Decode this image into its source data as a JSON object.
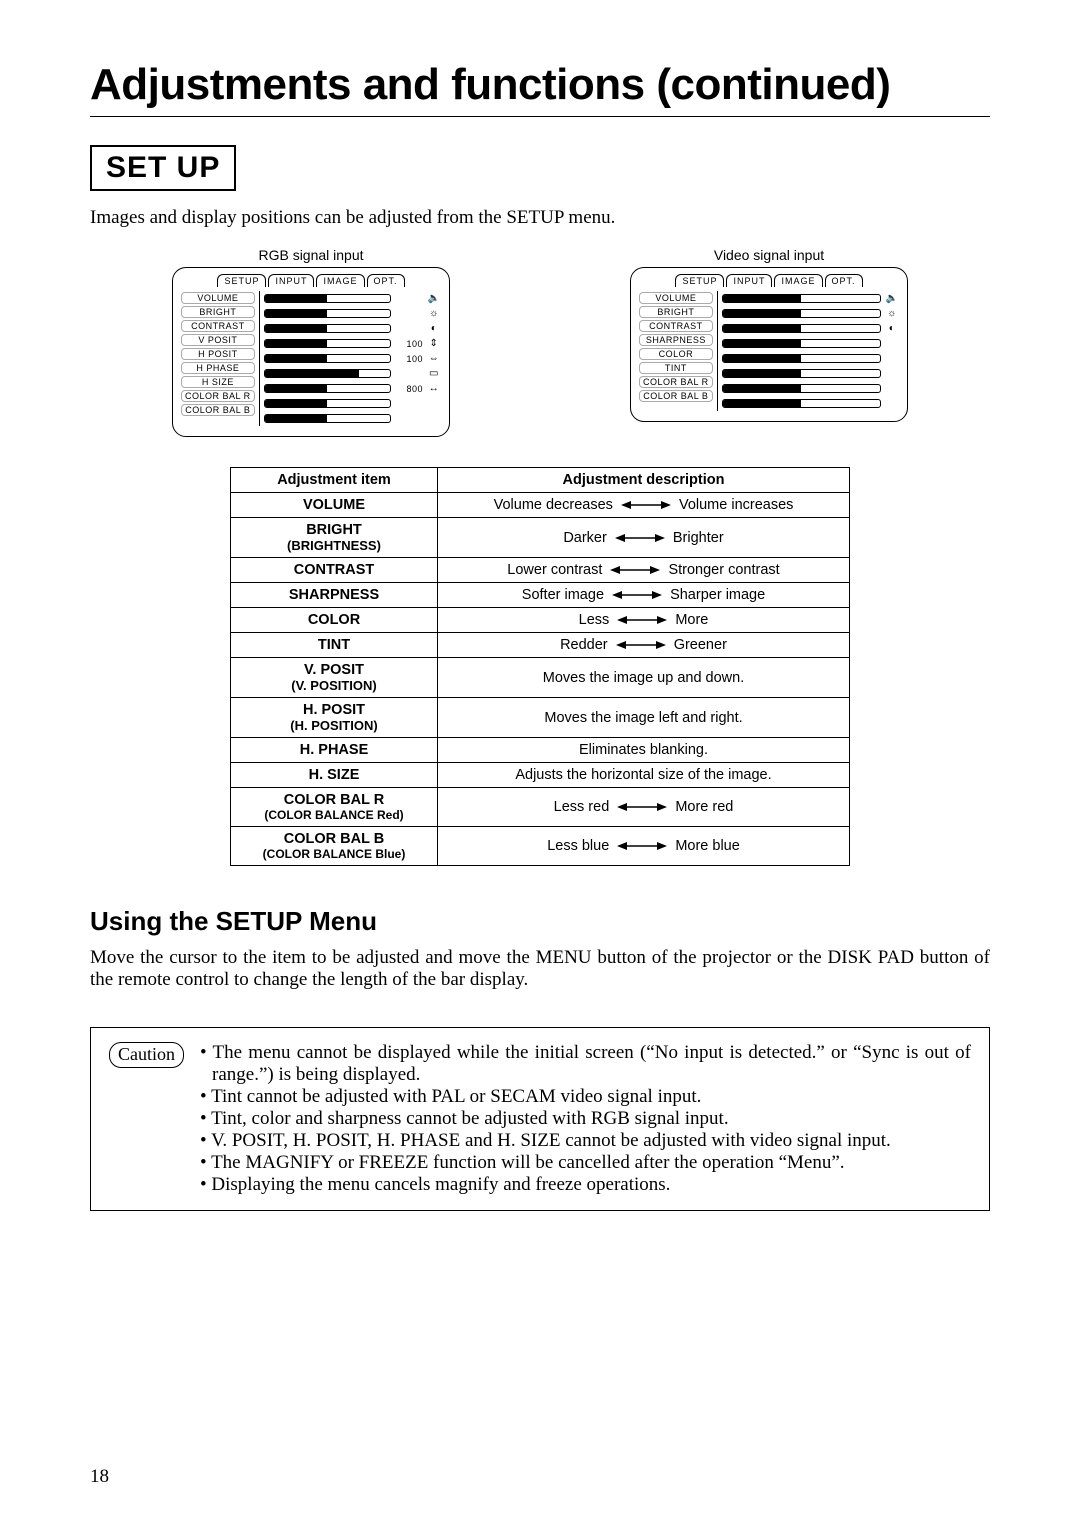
{
  "title": "Adjustments and functions (continued)",
  "setup_label": "SET UP",
  "intro": "Images and display positions can be adjusted from the SETUP menu.",
  "page_number": "18",
  "osd": {
    "tabs": [
      "SETUP",
      "INPUT",
      "IMAGE",
      "OPT."
    ],
    "rgb": {
      "caption": "RGB signal input",
      "items": [
        {
          "label": "VOLUME",
          "fill": 50,
          "num": "",
          "icon": "🔈"
        },
        {
          "label": "BRIGHT",
          "fill": 50,
          "num": "",
          "icon": "☼"
        },
        {
          "label": "CONTRAST",
          "fill": 50,
          "num": "",
          "icon": "◐"
        },
        {
          "label": "V  POSIT",
          "fill": 50,
          "num": "100",
          "icon": "⇕"
        },
        {
          "label": "H  POSIT",
          "fill": 50,
          "num": "100",
          "icon": "⇔"
        },
        {
          "label": "H  PHASE",
          "fill": 75,
          "num": "",
          "icon": "▭"
        },
        {
          "label": "H  SIZE",
          "fill": 50,
          "num": "800",
          "icon": "↔"
        },
        {
          "label": "COLOR BAL  R",
          "fill": 50,
          "num": "",
          "icon": ""
        },
        {
          "label": "COLOR BAL  B",
          "fill": 50,
          "num": "",
          "icon": ""
        }
      ]
    },
    "video": {
      "caption": "Video signal input",
      "items": [
        {
          "label": "VOLUME",
          "fill": 50,
          "icon": "🔈"
        },
        {
          "label": "BRIGHT",
          "fill": 50,
          "icon": "☼"
        },
        {
          "label": "CONTRAST",
          "fill": 50,
          "icon": "◐"
        },
        {
          "label": "SHARPNESS",
          "fill": 50,
          "icon": ""
        },
        {
          "label": "COLOR",
          "fill": 50,
          "icon": ""
        },
        {
          "label": "TINT",
          "fill": 50,
          "icon": ""
        },
        {
          "label": "COLOR BAL  R",
          "fill": 50,
          "icon": ""
        },
        {
          "label": "COLOR BAL  B",
          "fill": 50,
          "icon": ""
        }
      ]
    }
  },
  "table": {
    "head_item": "Adjustment item",
    "head_desc": "Adjustment description",
    "rows": [
      {
        "name": "VOLUME",
        "type": "arrow",
        "left": "Volume decreases",
        "right": "Volume increases"
      },
      {
        "name": "BRIGHT",
        "sub": "(BRIGHTNESS)",
        "type": "arrow",
        "left": "Darker",
        "right": "Brighter"
      },
      {
        "name": "CONTRAST",
        "type": "arrow",
        "left": "Lower contrast",
        "right": "Stronger contrast"
      },
      {
        "name": "SHARPNESS",
        "type": "arrow",
        "left": "Softer image",
        "right": "Sharper image"
      },
      {
        "name": "COLOR",
        "type": "arrow",
        "left": "Less",
        "right": "More"
      },
      {
        "name": "TINT",
        "type": "arrow",
        "left": "Redder",
        "right": "Greener"
      },
      {
        "name": "V. POSIT",
        "sub": "(V. POSITION)",
        "type": "text",
        "text": "Moves the image up and down."
      },
      {
        "name": "H. POSIT",
        "sub": "(H. POSITION)",
        "type": "text",
        "text": "Moves the image left and right."
      },
      {
        "name": "H. PHASE",
        "type": "text",
        "text": "Eliminates blanking."
      },
      {
        "name": "H. SIZE",
        "type": "text",
        "text": "Adjusts the horizontal size of the image."
      },
      {
        "name": "COLOR BAL  R",
        "sub": "(COLOR BALANCE Red)",
        "sub2": true,
        "type": "arrow",
        "left": "Less   red",
        "right": "More   red"
      },
      {
        "name": "COLOR BAL  B",
        "sub": "(COLOR BALANCE Blue)",
        "sub2": true,
        "type": "arrow",
        "left": "Less   blue",
        "right": "More blue"
      }
    ]
  },
  "using": {
    "heading": "Using the SETUP Menu",
    "paragraph": "Move the cursor to the item to be adjusted and move the MENU button of the projector or the DISK PAD button of the remote control to change the length of the bar display."
  },
  "caution": {
    "label": "Caution",
    "items": [
      "The menu cannot be displayed while the initial screen (“No input is detected.” or “Sync is out of range.”) is being displayed.",
      "Tint cannot be adjusted with PAL or SECAM video signal input.",
      "Tint, color and sharpness cannot be adjusted with RGB signal input.",
      "V. POSIT, H. POSIT, H. PHASE and H. SIZE cannot be adjusted with video signal input.",
      "The MAGNIFY or FREEZE function will be cancelled after the operation “Menu”.",
      "Displaying the menu cancels magnify and freeze operations."
    ]
  }
}
